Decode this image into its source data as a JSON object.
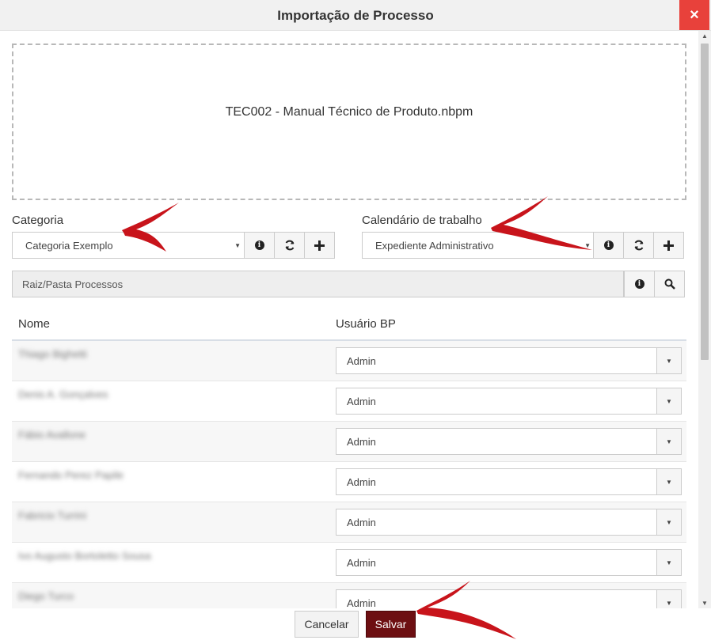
{
  "dialog": {
    "title": "Importação de Processo",
    "close_icon": "×"
  },
  "dropzone": {
    "file_name": "TEC002 - Manual Técnico de Produto.nbpm"
  },
  "categoria": {
    "label": "Categoria",
    "value": "Categoria Exemplo",
    "buttons": [
      "info-icon",
      "refresh-icon",
      "plus-icon"
    ]
  },
  "calendario": {
    "label": "Calendário de trabalho",
    "value": "Expediente Administrativo",
    "buttons": [
      "info-icon",
      "refresh-icon",
      "plus-icon"
    ]
  },
  "folder": {
    "path": "Raiz/Pasta Processos",
    "buttons": [
      "info-icon",
      "search-icon"
    ]
  },
  "table": {
    "columns": [
      "Nome",
      "Usuário BP"
    ],
    "rows": [
      {
        "name": "Thiago Bighetti",
        "user": "Admin"
      },
      {
        "name": "Denis A. Gonçalves",
        "user": "Admin"
      },
      {
        "name": "Fábio Avallone",
        "user": "Admin"
      },
      {
        "name": "Fernando Perez Papile",
        "user": "Admin"
      },
      {
        "name": "Fabricio Turrini",
        "user": "Admin"
      },
      {
        "name": "Ivo Augusto Bortoletto Sousa",
        "user": "Admin"
      },
      {
        "name": "Diego Turco",
        "user": "Admin"
      }
    ]
  },
  "footer": {
    "cancel_label": "Cancelar",
    "save_label": "Salvar"
  },
  "colors": {
    "close": "#e8413b",
    "save": "#6d0f12",
    "annotation_arrow": "#c8141b"
  }
}
